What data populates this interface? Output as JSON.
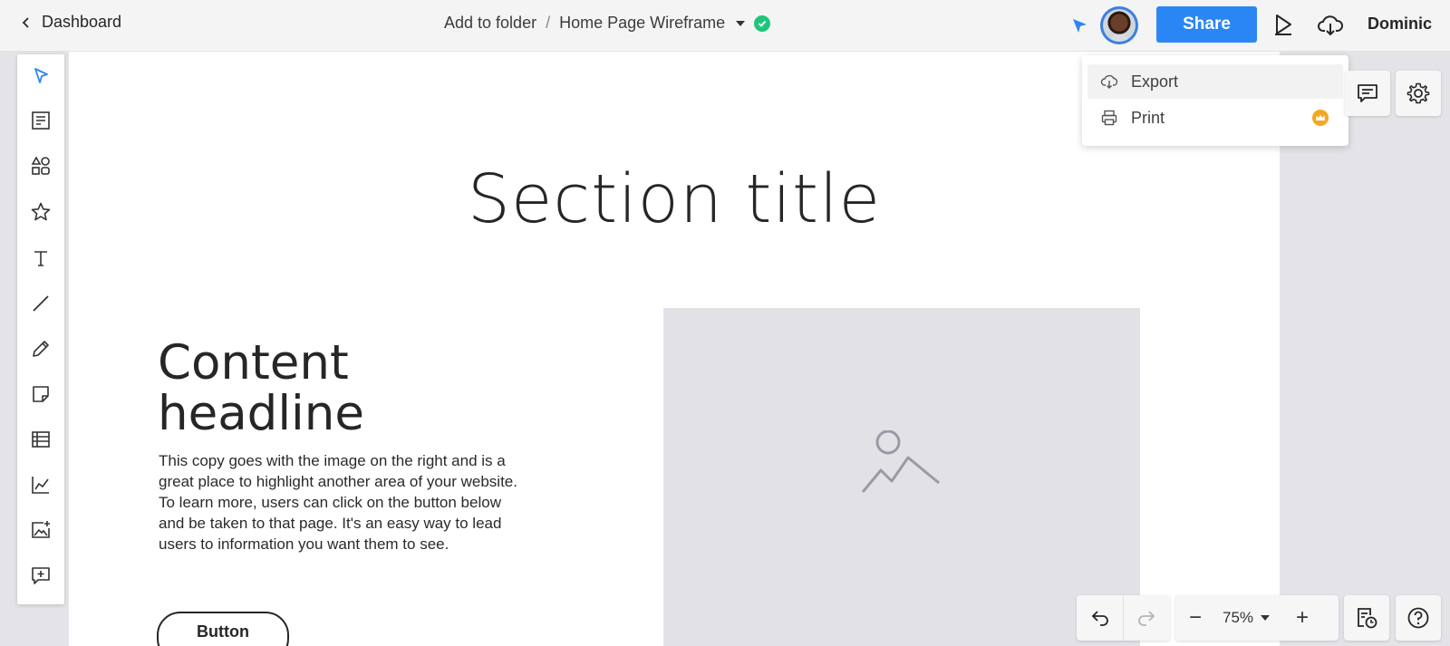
{
  "topbar": {
    "back_label": "Dashboard",
    "folder_label": "Add to folder",
    "separator": "/",
    "doc_title": "Home Page Wireframe",
    "share_label": "Share",
    "user_name": "Dominic",
    "brand_color": "#2b86f5",
    "saved_color": "#1fc57a"
  },
  "toolbar": {
    "tools": [
      "select-tool",
      "text-block-tool",
      "shapes-tool",
      "icons-tool",
      "text-tool",
      "line-tool",
      "pen-tool",
      "sticky-note-tool",
      "table-tool",
      "chart-tool",
      "image-tool",
      "comment-tool"
    ]
  },
  "canvas": {
    "section_title": "Section title",
    "headline_line1": "Content",
    "headline_line2": "headline",
    "copy": "This copy goes with the image on the right and is a great place to highlight another area of your website. To learn more, users can click on the button below and be taken to that page. It's an easy way to lead users to information you want them to see.",
    "button_label": "Button"
  },
  "export_menu": {
    "items": [
      {
        "label": "Export",
        "icon": "cloud-download-icon"
      },
      {
        "label": "Print",
        "icon": "printer-icon",
        "badge": "crown-icon"
      }
    ]
  },
  "zoom": {
    "value": "75%",
    "minus": "−",
    "plus": "+"
  }
}
